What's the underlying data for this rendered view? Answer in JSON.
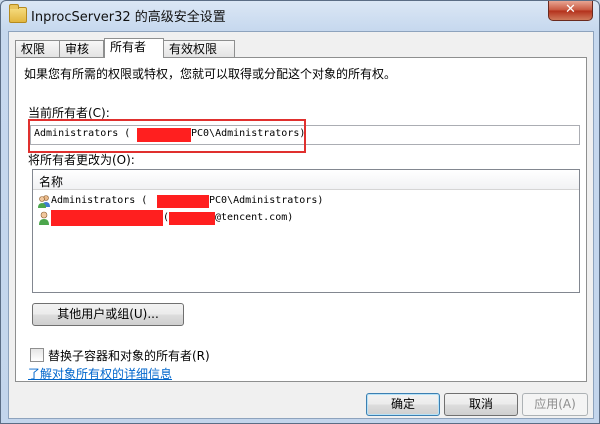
{
  "window": {
    "title": "InprocServer32 的高级安全设置",
    "close_glyph": "✕"
  },
  "tabs": [
    {
      "label": "权限"
    },
    {
      "label": "审核"
    },
    {
      "label": "所有者",
      "active": true
    },
    {
      "label": "有效权限"
    }
  ],
  "owner_tab": {
    "intro": "如果您有所需的权限或特权，您就可以取得或分配这个对象的所有权。",
    "current_owner_label": "当前所有者(C):",
    "current_owner_value_prefix": "Administrators (",
    "current_owner_value_suffix": "PC0\\Administrators)",
    "change_owner_label": "将所有者更改为(O):",
    "list_header": "名称",
    "candidates": [
      {
        "text_prefix": "Administrators (",
        "text_suffix": "PC0\\Administrators)",
        "icon": "user-group-icon"
      },
      {
        "text_prefix": "(",
        "text_suffix": "@tencent.com)",
        "icon": "user-icon"
      }
    ],
    "other_users_button": "其他用户或组(U)...",
    "replace_checkbox_label": "替换子容器和对象的所有者(R)",
    "replace_checked": false,
    "learn_more_link": "了解对象所有权的详细信息"
  },
  "buttons": {
    "ok": "确定",
    "cancel": "取消",
    "apply": "应用(A)"
  },
  "colors": {
    "redaction": "#ff1f1f",
    "highlight_box": "#e0302e",
    "link": "#0066cc"
  }
}
